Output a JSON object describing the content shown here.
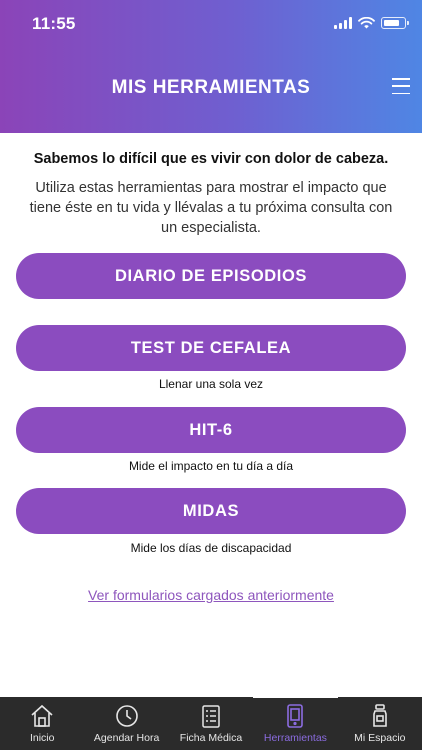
{
  "status": {
    "time": "11:55"
  },
  "header": {
    "title": "MIS HERRAMIENTAS"
  },
  "intro": {
    "bold": "Sabemos lo difícil que es vivir con dolor de cabeza.",
    "text": "Utiliza estas herramientas para mostrar el impacto que tiene éste en tu vida y llévalas a tu próxima consulta con un especialista."
  },
  "tools": [
    {
      "label": "DIARIO DE EPISODIOS",
      "caption": ""
    },
    {
      "label": "TEST DE CEFALEA",
      "caption": "Llenar una sola vez"
    },
    {
      "label": "HIT-6",
      "caption": "Mide el impacto en tu día a día"
    },
    {
      "label": "MIDAS",
      "caption": "Mide los días de discapacidad"
    }
  ],
  "link": "Ver formularios cargados anteriormente",
  "tabbar": {
    "active": "Herramientas",
    "tabs": [
      {
        "label": "Inicio",
        "icon": "home-icon"
      },
      {
        "label": "Agendar Hora",
        "icon": "clock-icon"
      },
      {
        "label": "Ficha Médica",
        "icon": "clipboard-icon"
      },
      {
        "label": "Herramientas",
        "icon": "tablet-icon"
      },
      {
        "label": "Mi Espacio",
        "icon": "jar-icon"
      }
    ]
  },
  "colors": {
    "accent": "#8b4cbf",
    "link": "#8e56bd",
    "tabbar": "#2b2b2b",
    "tab_active": "#8b6ce0"
  }
}
